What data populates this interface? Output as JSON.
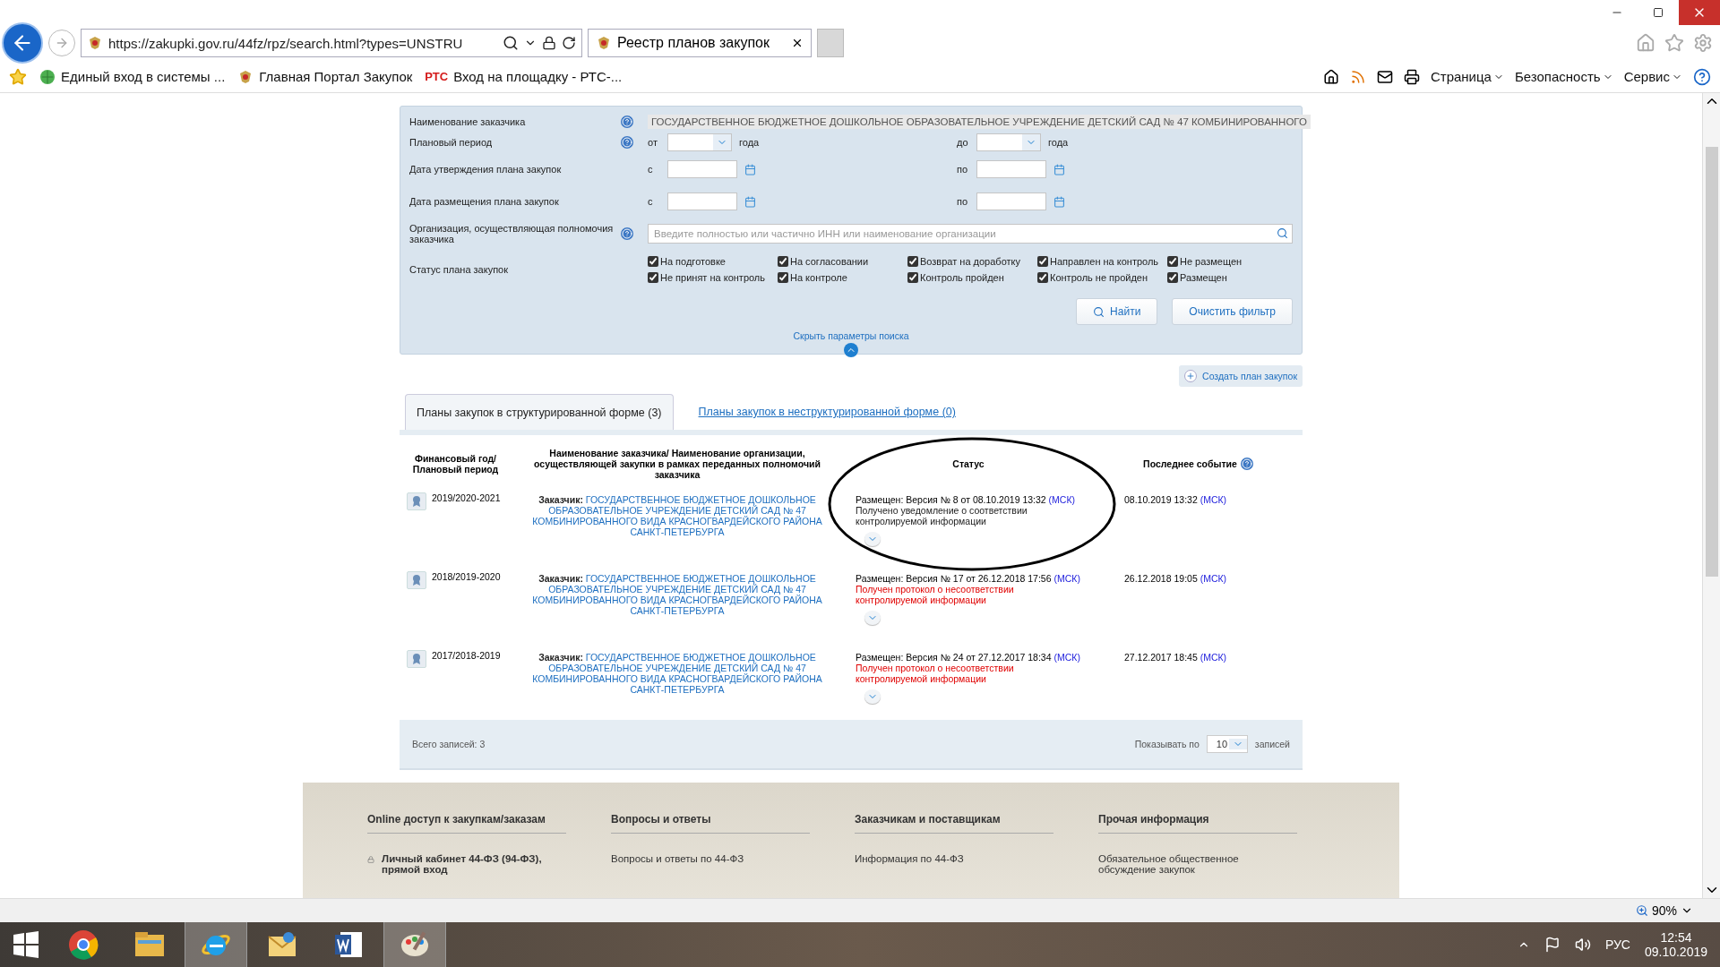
{
  "browser": {
    "address": "https://zakupki.gov.ru/44fz/rpz/search.html?types=UNSTRU",
    "tabs": [
      {
        "title": "Реестр планов закупок",
        "selected": true
      }
    ],
    "favorites": [
      {
        "label": "Единый вход в системы ...",
        "kind": "green"
      },
      {
        "label": "Главная Портал Закупок",
        "kind": "emblem"
      },
      {
        "label": "Вход на площадку - РТС-...",
        "kind": "badge",
        "badge": "РТС"
      }
    ],
    "commands": [
      "Страница",
      "Безопасность",
      "Сервис"
    ]
  },
  "filter": {
    "customer": {
      "label": "Наименование заказчика",
      "value": "ГОСУДАРСТВЕННОЕ БЮДЖЕТНОЕ ДОШКОЛЬНОЕ ОБРАЗОВАТЕЛЬНОЕ УЧРЕЖДЕНИЕ ДЕТСКИЙ САД № 47 КОМБИНИРОВАННОГО"
    },
    "period": {
      "label": "Плановый период",
      "from": "от",
      "to": "до",
      "suffix_from": "года",
      "suffix_to": "года"
    },
    "dates": [
      {
        "label": "Дата утверждения плана закупок",
        "from": "с",
        "to": "по"
      },
      {
        "label": "Дата размещения плана закупок",
        "from": "с",
        "to": "по"
      }
    ],
    "organization": {
      "label": "Организация, осуществляющая полномочия заказчика",
      "placeholder": "Введите полностью или частично ИНН или наименование организации"
    },
    "status": {
      "label": "Статус плана закупок",
      "options": [
        {
          "label": "На подготовке",
          "checked": true
        },
        {
          "label": "На согласовании",
          "checked": true
        },
        {
          "label": "Возврат на доработку",
          "checked": true
        },
        {
          "label": "Направлен на контроль",
          "checked": true
        },
        {
          "label": "Не размещен",
          "checked": true
        },
        {
          "label": "Не принят на контроль",
          "checked": true
        },
        {
          "label": "На контроле",
          "checked": true
        },
        {
          "label": "Контроль пройден",
          "checked": true
        },
        {
          "label": "Контроль не пройден",
          "checked": true
        },
        {
          "label": "Размещен",
          "checked": true
        }
      ]
    },
    "buttons": [
      {
        "label": "Найти",
        "kind": "search"
      },
      {
        "label": "Очистить фильтр",
        "kind": "plain"
      }
    ],
    "hide_link": "Скрыть параметры поиска"
  },
  "create_button": "Создать план закупок",
  "tabs": [
    {
      "label": "Планы закупок в структурированной форме (3)",
      "selected": true
    },
    {
      "label": "Планы закупок в неструктурированной форме (0)",
      "selected": false
    }
  ],
  "table": {
    "columns": [
      "Финансовый год/ Плановый период",
      "Наименование заказчика/ Наименование организации, осуществляющей закупки в рамках переданных полномочий заказчика",
      "Статус",
      "Последнее событие"
    ],
    "rows": [
      {
        "year": "2019/2020-2021",
        "customer_label": "Заказчик:",
        "customer": "ГОСУДАРСТВЕННОЕ БЮДЖЕТНОЕ ДОШКОЛЬНОЕ ОБРАЗОВАТЕЛЬНОЕ УЧРЕЖДЕНИЕ ДЕТСКИЙ САД № 47 КОМБИНИРОВАННОГО ВИДА КРАСНОГВАРДЕЙСКОГО РАЙОНА САНКТ-ПЕТЕРБУРГА",
        "status": "Размещен: Версия № 8 от 08.10.2019 13:32",
        "status_tz": "(МСК)",
        "note": "Получено уведомление о соответствии контролируемой информации",
        "alert": false,
        "event": "08.10.2019 13:32",
        "event_tz": "(МСК)"
      },
      {
        "year": "2018/2019-2020",
        "customer_label": "Заказчик:",
        "customer": "ГОСУДАРСТВЕННОЕ БЮДЖЕТНОЕ ДОШКОЛЬНОЕ ОБРАЗОВАТЕЛЬНОЕ УЧРЕЖДЕНИЕ ДЕТСКИЙ САД № 47 КОМБИНИРОВАННОГО ВИДА КРАСНОГВАРДЕЙСКОГО РАЙОНА САНКТ-ПЕТЕРБУРГА",
        "status": "Размещен: Версия № 17 от 26.12.2018 17:56",
        "status_tz": "(МСК)",
        "note": "Получен протокол о несоответствии контролируемой информации",
        "alert": true,
        "event": "26.12.2018 19:05",
        "event_tz": "(МСК)"
      },
      {
        "year": "2017/2018-2019",
        "customer_label": "Заказчик:",
        "customer": "ГОСУДАРСТВЕННОЕ БЮДЖЕТНОЕ ДОШКОЛЬНОЕ ОБРАЗОВАТЕЛЬНОЕ УЧРЕЖДЕНИЕ ДЕТСКИЙ САД № 47 КОМБИНИРОВАННОГО ВИДА КРАСНОГВАРДЕЙСКОГО РАЙОНА САНКТ-ПЕТЕРБУРГА",
        "status": "Размещен: Версия № 24 от 27.12.2017 18:34",
        "status_tz": "(МСК)",
        "note": "Получен протокол о несоответствии контролируемой информации",
        "alert": true,
        "event": "27.12.2017 18:45",
        "event_tz": "(МСК)"
      }
    ],
    "total": "Всего записей: 3",
    "page_size_label": "Показывать по",
    "page_size": "10",
    "page_size_suffix": "записей"
  },
  "site_footer": [
    {
      "heading": "Online доступ к закупкам/заказам",
      "items": [
        {
          "label": "Личный кабинет 44-ФЗ (94-ФЗ), прямой вход",
          "locked": true
        }
      ]
    },
    {
      "heading": "Вопросы и ответы",
      "items": [
        {
          "label": "Вопросы и ответы по 44-ФЗ",
          "locked": false
        }
      ]
    },
    {
      "heading": "Заказчикам и поставщикам",
      "items": [
        {
          "label": "Информация по 44-ФЗ",
          "locked": false
        }
      ]
    },
    {
      "heading": "Прочая информация",
      "items": [
        {
          "label": "Обязательное общественное обсуждение закупок",
          "locked": false
        }
      ]
    }
  ],
  "status_bar": {
    "zoom": "90%"
  },
  "taskbar": {
    "apps": [
      {
        "kind": "chrome",
        "selected": false
      },
      {
        "kind": "folder",
        "selected": false
      },
      {
        "kind": "ie",
        "selected": true
      },
      {
        "kind": "mail",
        "selected": false
      },
      {
        "kind": "word",
        "selected": false
      },
      {
        "kind": "paint",
        "selected": true
      }
    ],
    "language": "РУС",
    "time": "12:54",
    "date": "09.10.2019"
  }
}
